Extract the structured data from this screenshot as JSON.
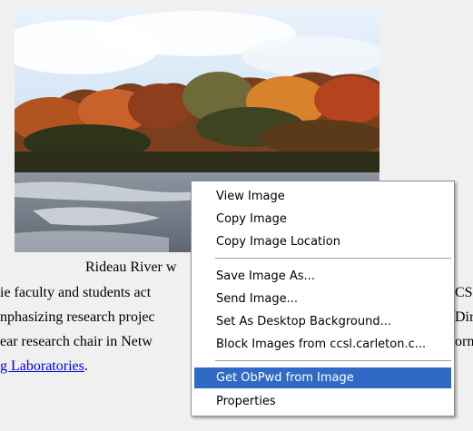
{
  "page": {
    "caption_visible": "Rideau River w",
    "para_lines": [
      "ie faculty and students act",
      "nphasizing research projec",
      "ear research chair in Netw"
    ],
    "link_text": "g Laboratories",
    "link_suffix": ".",
    "right_frags": [
      "CS",
      "Dir",
      "orn"
    ]
  },
  "photo": {
    "alt": "Rideau River autumn photo"
  },
  "context_menu": {
    "items": [
      {
        "label": "View Image",
        "selected": false
      },
      {
        "label": "Copy Image",
        "selected": false
      },
      {
        "label": "Copy Image Location",
        "selected": false
      },
      {
        "label": "Save Image As...",
        "selected": false
      },
      {
        "label": "Send Image...",
        "selected": false
      },
      {
        "label": "Set As Desktop Background...",
        "selected": false
      },
      {
        "label": "Block Images from ccsl.carleton.c...",
        "selected": false
      },
      {
        "label": "Get ObPwd from Image",
        "selected": true
      },
      {
        "label": "Properties",
        "selected": false
      }
    ],
    "selected_bg": "#316ac5"
  }
}
